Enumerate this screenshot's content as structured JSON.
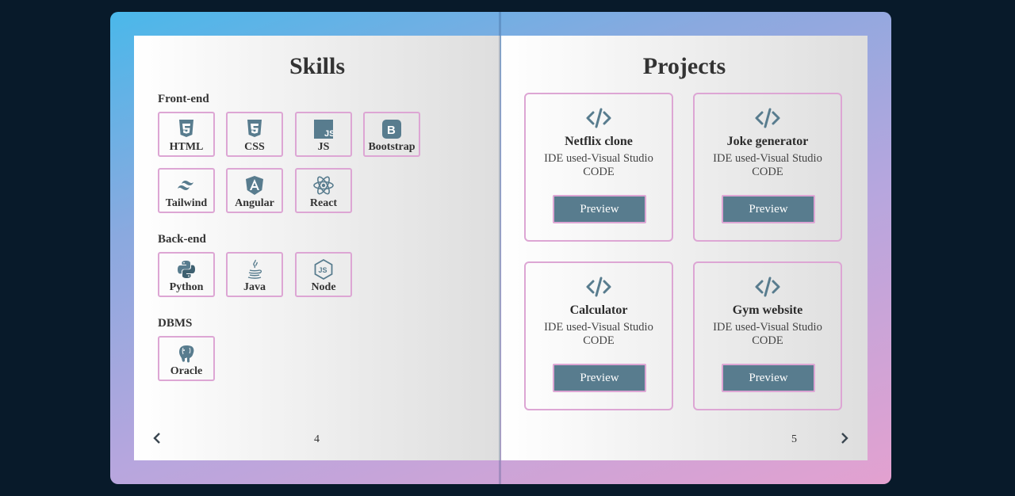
{
  "left_page": {
    "title": "Skills",
    "page_number": "4",
    "sections": [
      {
        "label": "Front-end",
        "skills": [
          {
            "label": "HTML",
            "icon": "html5-icon"
          },
          {
            "label": "CSS",
            "icon": "css3-icon"
          },
          {
            "label": "JS",
            "icon": "javascript-icon"
          },
          {
            "label": "Bootstrap",
            "icon": "bootstrap-icon"
          },
          {
            "label": "Tailwind",
            "icon": "tailwind-icon"
          },
          {
            "label": "Angular",
            "icon": "angular-icon"
          },
          {
            "label": "React",
            "icon": "react-icon"
          }
        ]
      },
      {
        "label": "Back-end",
        "skills": [
          {
            "label": "Python",
            "icon": "python-icon"
          },
          {
            "label": "Java",
            "icon": "java-icon"
          },
          {
            "label": "Node",
            "icon": "nodejs-icon"
          }
        ]
      },
      {
        "label": "DBMS",
        "skills": [
          {
            "label": "Oracle",
            "icon": "postgresql-icon"
          }
        ]
      }
    ]
  },
  "right_page": {
    "title": "Projects",
    "page_number": "5",
    "projects": [
      {
        "title": "Netflix clone",
        "description": "IDE used-Visual Studio CODE",
        "button": "Preview"
      },
      {
        "title": "Joke generator",
        "description": "IDE used-Visual Studio CODE",
        "button": "Preview"
      },
      {
        "title": "Calculator",
        "description": "IDE used-Visual Studio CODE",
        "button": "Preview"
      },
      {
        "title": "Gym website",
        "description": "IDE used-Visual Studio CODE",
        "button": "Preview"
      }
    ]
  },
  "nav": {
    "prev_icon": "chevron-left-icon",
    "next_icon": "chevron-right-icon"
  },
  "colors": {
    "accent": "#587c8e",
    "border": "#dda6d4",
    "background": "#081a2a"
  }
}
